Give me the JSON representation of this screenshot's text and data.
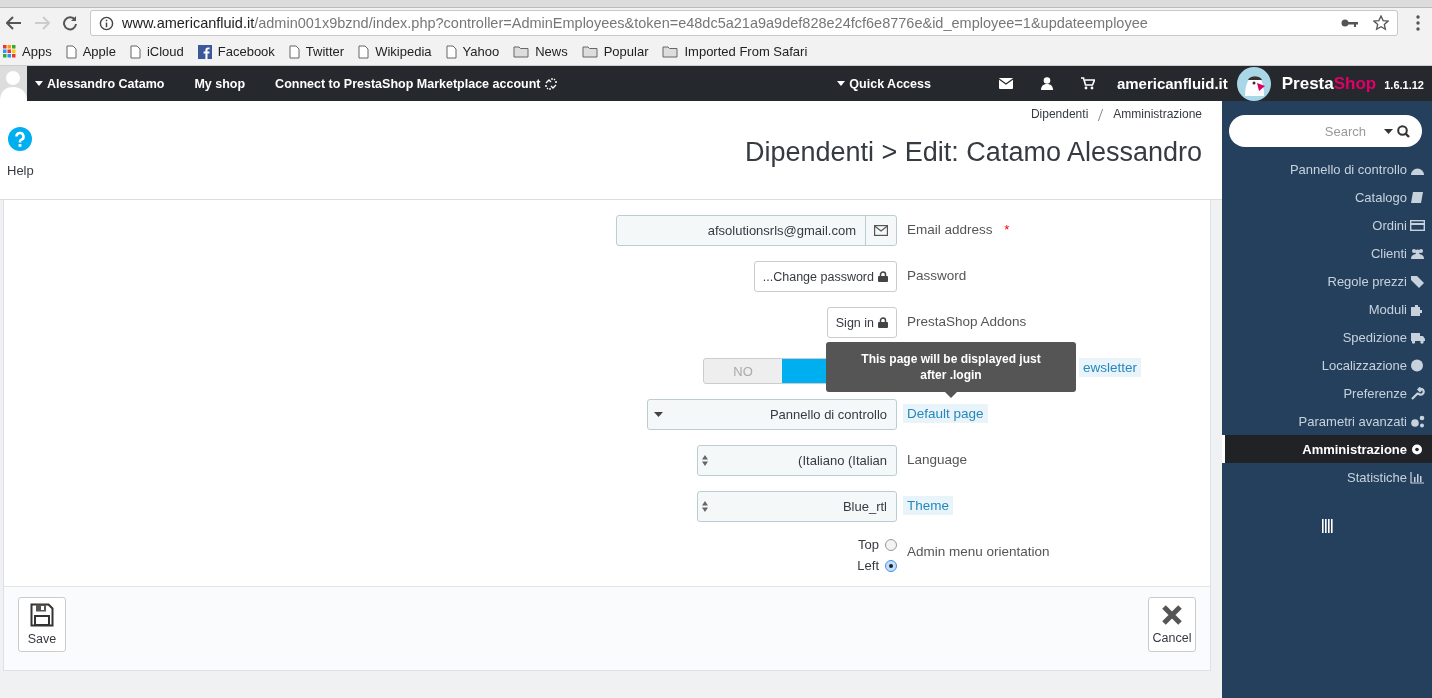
{
  "browser": {
    "url_domain": "www.americanfluid.it",
    "url_path": "/admin001x9bznd/index.php?controller=AdminEmployees&token=e48dc5a21a9a9def828e24fcf6e8776e&id_employee=1&updateemployee",
    "bookmarks": [
      {
        "label": "Apps",
        "kind": "apps"
      },
      {
        "label": "Apple",
        "kind": "page"
      },
      {
        "label": "iCloud",
        "kind": "page"
      },
      {
        "label": "Facebook",
        "kind": "facebook"
      },
      {
        "label": "Twitter",
        "kind": "page"
      },
      {
        "label": "Wikipedia",
        "kind": "page"
      },
      {
        "label": "Yahoo",
        "kind": "page"
      },
      {
        "label": "News",
        "kind": "folder"
      },
      {
        "label": "Popular",
        "kind": "folder"
      },
      {
        "label": "Imported From Safari",
        "kind": "folder"
      }
    ]
  },
  "topbar": {
    "user": "Alessandro Catamo",
    "my_shop": "My shop",
    "connect": "Connect to PrestaShop Marketplace account",
    "quick_access": "Quick Access",
    "shop_name": "americanfluid.it",
    "brand_first": "Presta",
    "brand_second": "Shop",
    "version": "1.6.1.12"
  },
  "header": {
    "help": "Help",
    "breadcrumb": [
      "Dipendenti",
      "Amministrazione"
    ],
    "title": "Dipendenti > Edit: Catamo Alessandro"
  },
  "form": [
    {
      "kind": "input",
      "value": "afsolutionsrls@gmail.com",
      "label": "Email address",
      "required_mark": "*",
      "hint": false
    },
    {
      "kind": "button",
      "value": "...Change password",
      "label": "Password",
      "hint": false
    },
    {
      "kind": "button",
      "value": "Sign in",
      "label": "PrestaShop Addons",
      "hint": false
    },
    {
      "kind": "switch",
      "value": "NO",
      "on": true,
      "label": "ewsletter",
      "hint": true
    },
    {
      "kind": "select",
      "value": "Pannello di controllo",
      "label": "Default page",
      "hint": true
    },
    {
      "kind": "spin",
      "value": "(Italiano (Italian",
      "label": "Language",
      "hint": false
    },
    {
      "kind": "spin",
      "value": "Blue_rtl",
      "label": "Theme",
      "hint": true
    },
    {
      "kind": "radio",
      "label": "Admin menu orientation",
      "hint": false,
      "options": [
        {
          "label": "Top",
          "selected": false
        },
        {
          "label": "Left",
          "selected": true
        }
      ]
    }
  ],
  "tooltip": "This page will be displayed just after .login",
  "footer": {
    "save": "Save",
    "cancel": "Cancel"
  },
  "sidebar": {
    "search_placeholder": "Search",
    "items": [
      {
        "label": "Pannello di controllo",
        "selected": false
      },
      {
        "label": "Catalogo",
        "selected": false
      },
      {
        "label": "Ordini",
        "selected": false
      },
      {
        "label": "Clienti",
        "selected": false
      },
      {
        "label": "Regole prezzi",
        "selected": false
      },
      {
        "label": "Moduli",
        "selected": false
      },
      {
        "label": "Spedizione",
        "selected": false
      },
      {
        "label": "Localizzazione",
        "selected": false
      },
      {
        "label": "Preferenze",
        "selected": false
      },
      {
        "label": "Parametri avanzati",
        "selected": false
      },
      {
        "label": "Amministrazione",
        "selected": true
      },
      {
        "label": "Statistiche",
        "selected": false
      }
    ]
  }
}
